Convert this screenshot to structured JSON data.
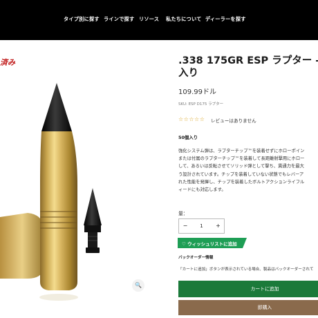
{
  "nav": {
    "items": [
      "タイプ別に探す",
      "ラインで探す",
      "リソース",
      "私たちについて",
      "ディーラーを探す"
    ]
  },
  "product": {
    "badge": "済み",
    "title_line1": ".338 175GR ESP ラプター -",
    "title_line2": "入り",
    "price": "109.99ドル",
    "sku": "SKU: ESP D175 ラプター",
    "stars": "☆☆☆☆☆",
    "reviews": "レビューはありません",
    "pack": "50個入り",
    "description": [
      "強化システム弾は、ラプターチップ™を装着せずにホローポイン",
      "または付属のラプターチップ™を装着して長距離射撃用にホロー",
      "して、あるいは反転させてソリッド弾として撃ち、貫通力を最大",
      "う設計されています。チップを装着していない状態でもレバーア",
      "れた性能を発揮し、チップを装着したボルトアクションライフル",
      "ィードにも対応します。"
    ],
    "qty_label": "量：",
    "qty_value": "1",
    "qty_minus": "−",
    "qty_plus": "+",
    "wishlist": "♡ ウィッシュリストに追加",
    "backorder_title": "バックオーダー情報",
    "backorder_text": "「カートに追加」ボタンが表示されている場合、製品はバックオーダーされて",
    "add_to_cart": "カートに追加",
    "buy_now": "即購入",
    "zoom": "🔍"
  },
  "colors": {
    "nav_bg": "#000000",
    "cart_button": "#1b7a3a",
    "buy_button": "#8a6a4c",
    "wishlist_badge": "#1e9e55",
    "badge_text": "#c01818",
    "brass": "#c9a64f",
    "tip": "#111111"
  },
  "icons": {
    "zoom": "search-icon",
    "wishlist": "heart-icon"
  }
}
